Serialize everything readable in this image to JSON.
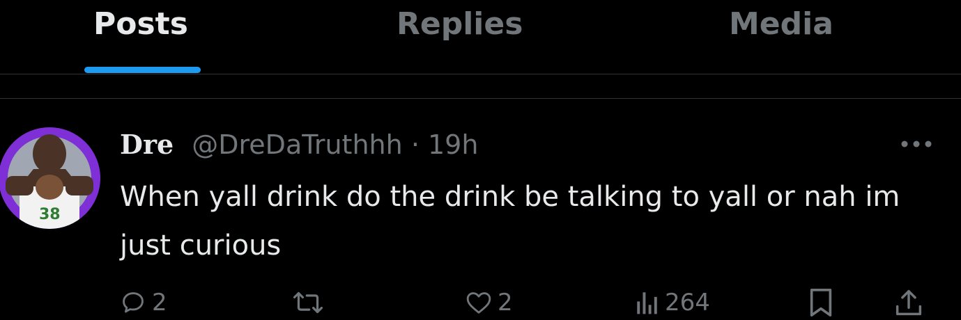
{
  "tabs": [
    {
      "label": "Posts",
      "active": true
    },
    {
      "label": "Replies",
      "active": false
    },
    {
      "label": "Media",
      "active": false
    }
  ],
  "tweet": {
    "display_name": "Dre",
    "handle": "@DreDaTruthhh",
    "separator": "·",
    "time": "19h",
    "text": "When yall drink do the drink be talking to yall or nah im just curious",
    "avatar_icon": "avatar-photo",
    "actions": {
      "reply_count": "2",
      "repost_count": "",
      "like_count": "2",
      "views_count": "264"
    }
  },
  "colors": {
    "background": "#000000",
    "text_primary": "#e7e9ea",
    "text_secondary": "#71767b",
    "accent": "#1d9bf0",
    "divider": "#2f3336",
    "avatar_bg": "#8a2be2"
  }
}
